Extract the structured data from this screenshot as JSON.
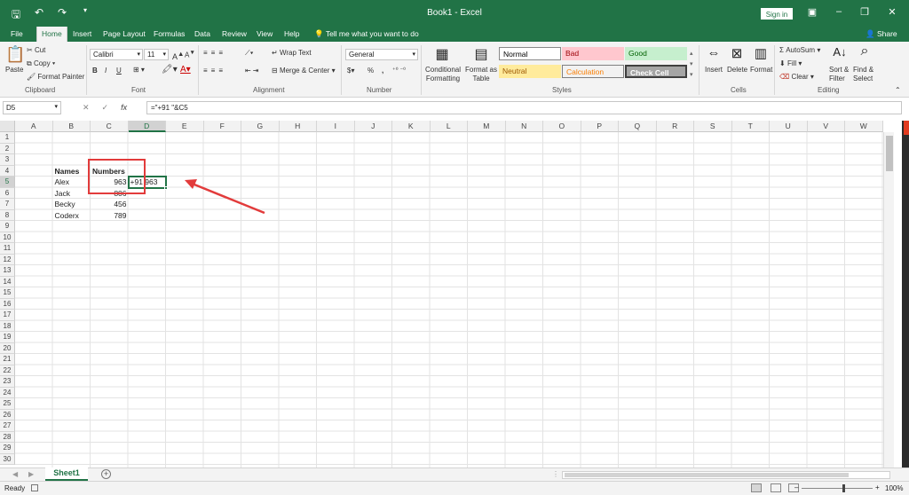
{
  "window": {
    "title": "Book1 - Excel",
    "signin_label": "Sign in",
    "qat_icons": [
      "save-icon",
      "undo-icon",
      "redo-icon",
      "customize-icon"
    ]
  },
  "tabs": [
    "File",
    "Home",
    "Insert",
    "Page Layout",
    "Formulas",
    "Data",
    "Review",
    "View",
    "Help"
  ],
  "active_tab": "Home",
  "tell_me": "Tell me what you want to do",
  "share": "Share",
  "ribbon": {
    "clipboard": {
      "paste": "Paste",
      "cut": "Cut",
      "copy": "Copy",
      "format_painter": "Format Painter",
      "label": "Clipboard"
    },
    "font": {
      "name": "Calibri",
      "size": "11",
      "bold": "B",
      "italic": "I",
      "underline": "U",
      "label": "Font"
    },
    "alignment": {
      "wrap_text": "Wrap Text",
      "merge_center": "Merge & Center",
      "label": "Alignment"
    },
    "number": {
      "format": "General",
      "percent": "%",
      "comma": ",",
      "label": "Number"
    },
    "styles": {
      "conditional": "Conditional Formatting",
      "format_as_table": "Format as Table",
      "items": [
        {
          "name": "Normal",
          "bg": "#ffffff",
          "fg": "#000000"
        },
        {
          "name": "Bad",
          "bg": "#ffc7ce",
          "fg": "#9c0006"
        },
        {
          "name": "Good",
          "bg": "#c6efce",
          "fg": "#006100"
        },
        {
          "name": "Neutral",
          "bg": "#ffeb9c",
          "fg": "#9c5700"
        },
        {
          "name": "Calculation",
          "bg": "#f2f2f2",
          "fg": "#fa7d00"
        },
        {
          "name": "Check Cell",
          "bg": "#a5a5a5",
          "fg": "#ffffff"
        }
      ],
      "label": "Styles"
    },
    "cells": {
      "insert": "Insert",
      "delete": "Delete",
      "format": "Format",
      "label": "Cells"
    },
    "editing": {
      "autosum": "AutoSum",
      "fill": "Fill",
      "clear": "Clear",
      "sort_filter": "Sort & Filter",
      "find_select": "Find & Select",
      "label": "Editing"
    }
  },
  "formula_bar": {
    "name_box": "D5",
    "formula": "=\"+91 \"&C5",
    "cancel": "✕",
    "enter": "✓",
    "fx": "fx"
  },
  "columns": [
    "A",
    "B",
    "C",
    "D",
    "E",
    "F",
    "G",
    "H",
    "I",
    "J",
    "K",
    "L",
    "M",
    "N",
    "O",
    "P",
    "Q",
    "R",
    "S",
    "T",
    "U",
    "V",
    "W"
  ],
  "selected_column": "D",
  "rows": [
    "1",
    "2",
    "3",
    "4",
    "5",
    "6",
    "7",
    "8",
    "9",
    "10",
    "11",
    "12",
    "13",
    "14",
    "15",
    "16",
    "17",
    "18",
    "19",
    "20",
    "21",
    "22",
    "23",
    "24",
    "25",
    "26",
    "27",
    "28",
    "29",
    "30"
  ],
  "selected_row": "5",
  "cells": {
    "B4": "Names",
    "C4": "Numbers",
    "B5": "Alex",
    "C5": "963",
    "D5": "+91 963",
    "B6": "Jack",
    "C6": "806",
    "B7": "Becky",
    "C7": "456",
    "B8": "Coderx",
    "C8": "789"
  },
  "annotation_color": "#e23b3b",
  "sheet": {
    "name": "Sheet1",
    "add": "+"
  },
  "status": {
    "ready": "Ready",
    "zoom": "100%"
  }
}
